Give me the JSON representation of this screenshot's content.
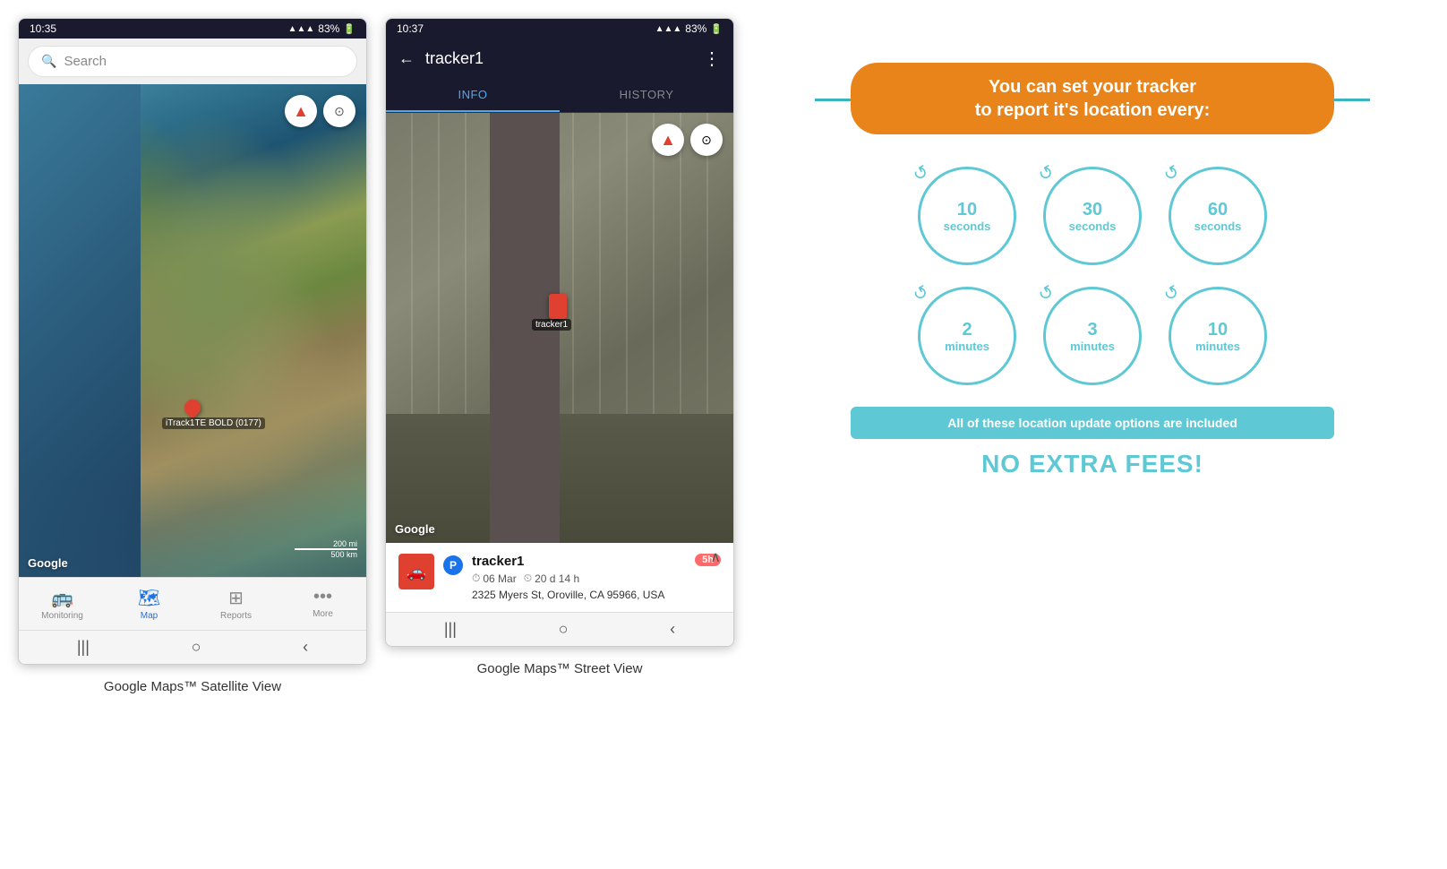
{
  "screen1": {
    "status_time": "10:35",
    "status_battery": "83%",
    "search_placeholder": "Search",
    "map_label": "iTrack1TE BOLD (0177)",
    "google_label": "Google",
    "scale_200mi": "200 mi",
    "scale_500km": "500 km",
    "nav_items": [
      {
        "icon": "🚌",
        "label": "Monitoring",
        "active": false
      },
      {
        "icon": "🗺",
        "label": "Map",
        "active": true
      },
      {
        "icon": "⊞",
        "label": "Reports",
        "active": false
      },
      {
        "icon": "•••",
        "label": "More",
        "active": false
      }
    ],
    "caption": "Google Maps™ Satellite View"
  },
  "screen2": {
    "status_time": "10:37",
    "status_battery": "83%",
    "back_icon": "←",
    "title": "tracker1",
    "more_icon": "⋮",
    "tabs": [
      {
        "label": "INFO",
        "active": true
      },
      {
        "label": "HISTORY",
        "active": false
      }
    ],
    "google_label": "Google",
    "tracker_label_map": "tracker1",
    "info_name": "tracker1",
    "info_date": "06 Mar",
    "info_duration": "20 d 14 h",
    "info_address": "2325 Myers St, Oroville, CA 95966, USA",
    "info_badge": "5h",
    "caption": "Google Maps™ Street View"
  },
  "graphic": {
    "headline": "You can set your tracker\nto report it's location every:",
    "circles": [
      {
        "number": "10",
        "unit": "seconds"
      },
      {
        "number": "30",
        "unit": "seconds"
      },
      {
        "number": "60",
        "unit": "seconds"
      },
      {
        "number": "2",
        "unit": "minutes"
      },
      {
        "number": "3",
        "unit": "minutes"
      },
      {
        "number": "10",
        "unit": "minutes"
      }
    ],
    "included_text": "All of these location update options are included",
    "no_fees_text": "NO EXTRA FEES!",
    "colors": {
      "orange": "#e8841a",
      "teal": "#5ec8d4"
    }
  }
}
